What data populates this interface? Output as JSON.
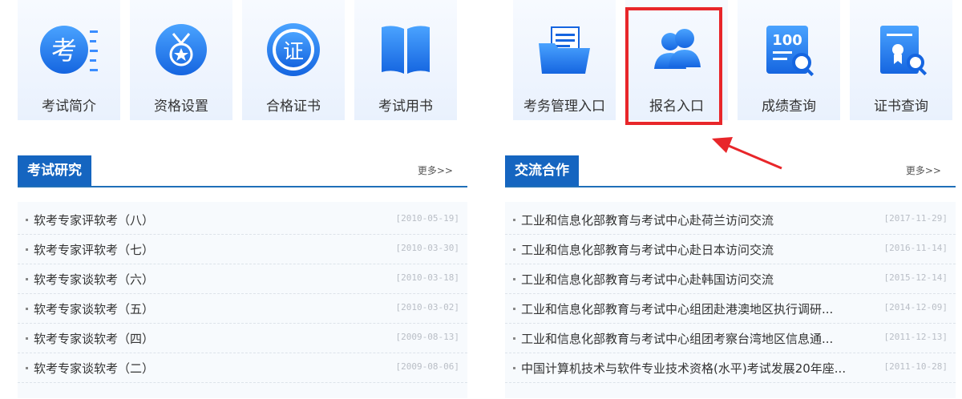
{
  "tiles_left": [
    {
      "label": "考试简介",
      "icon": "exam-intro-icon",
      "glyph": "考"
    },
    {
      "label": "资格设置",
      "icon": "medal-icon"
    },
    {
      "label": "合格证书",
      "icon": "certificate-seal-icon",
      "glyph": "证"
    },
    {
      "label": "考试用书",
      "icon": "book-icon"
    }
  ],
  "tiles_right": [
    {
      "label": "考务管理入口",
      "icon": "folder-icon"
    },
    {
      "label": "报名入口",
      "icon": "users-icon"
    },
    {
      "label": "成绩查询",
      "icon": "score-search-icon",
      "glyph": "100"
    },
    {
      "label": "证书查询",
      "icon": "certificate-search-icon"
    }
  ],
  "panel_left": {
    "title": "考试研究",
    "more": "更多>>",
    "items": [
      {
        "title": "软考专家评软考（八）",
        "date": "[2010-05-19]"
      },
      {
        "title": "软考专家评软考（七）",
        "date": "[2010-03-30]"
      },
      {
        "title": "软考专家谈软考（六）",
        "date": "[2010-03-18]"
      },
      {
        "title": "软考专家谈软考（五）",
        "date": "[2010-03-02]"
      },
      {
        "title": "软考专家谈软考（四）",
        "date": "[2009-08-13]"
      },
      {
        "title": "软考专家谈软考（二）",
        "date": "[2009-08-06]"
      }
    ]
  },
  "panel_right": {
    "title": "交流合作",
    "more": "更多>>",
    "items": [
      {
        "title": "工业和信息化部教育与考试中心赴荷兰访问交流",
        "date": "[2017-11-29]"
      },
      {
        "title": "工业和信息化部教育与考试中心赴日本访问交流",
        "date": "[2016-11-14]"
      },
      {
        "title": "工业和信息化部教育与考试中心赴韩国访问交流",
        "date": "[2015-12-14]"
      },
      {
        "title": "工业和信息化部教育与考试中心组团赴港澳地区执行调研...",
        "date": "[2014-12-09]"
      },
      {
        "title": "工业和信息化部教育与考试中心组团考察台湾地区信息通...",
        "date": "[2011-12-13]"
      },
      {
        "title": "中国计算机技术与软件专业技术资格(水平)考试发展20年座...",
        "date": "[2011-10-28]"
      }
    ]
  },
  "colors": {
    "accent": "#1565c0",
    "highlight": "#e8262a",
    "icon_blue": "#1a73e8"
  }
}
